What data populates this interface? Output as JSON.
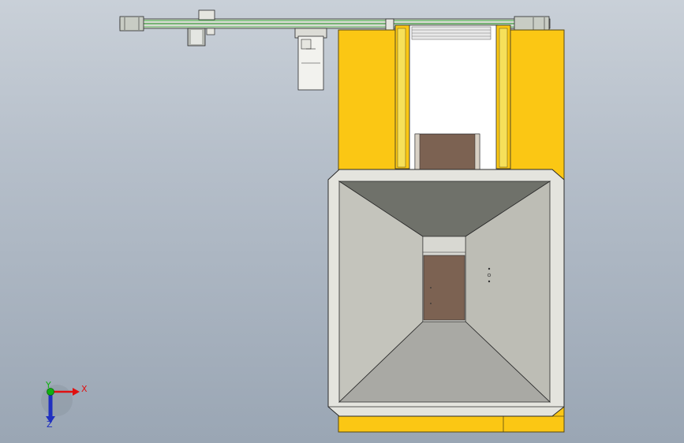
{
  "triad": {
    "x_label": "X",
    "y_label": "Y",
    "z_label": "Z",
    "x_color": "#e01010",
    "y_color": "#10b010",
    "z_color": "#2030c0"
  },
  "colors": {
    "frame_yellow": "#fbc714",
    "frame_outline": "#5a4a10",
    "hopper_light": "#c4c4bc",
    "hopper_mid": "#a9a9a4",
    "hopper_dark": "#6f716a",
    "brown_plate": "#7c6252",
    "rail_green": "#5fb85f"
  }
}
